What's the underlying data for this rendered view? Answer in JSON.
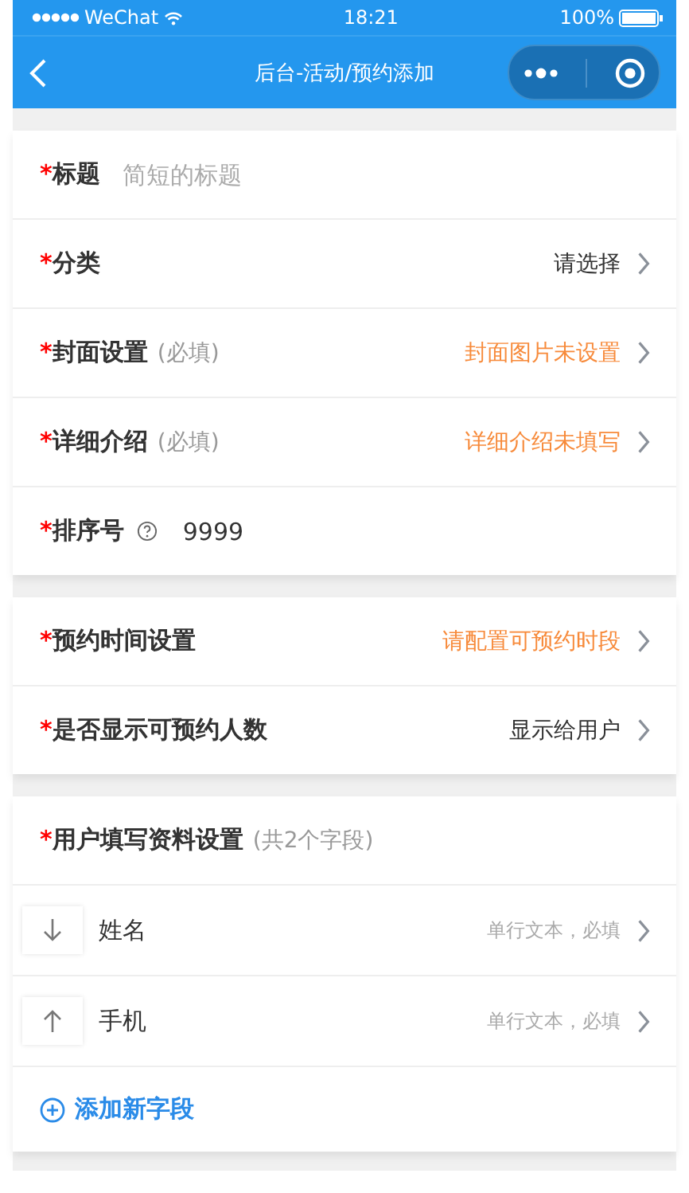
{
  "status_bar": {
    "carrier": "WeChat",
    "time": "18:21",
    "battery": "100%"
  },
  "nav": {
    "title": "后台-活动/预约添加"
  },
  "sections": [
    {
      "rows": [
        {
          "kind": "input",
          "required_mark": "*",
          "label": "标题",
          "placeholder": "简短的标题"
        },
        {
          "kind": "select",
          "required_mark": "*",
          "label": "分类",
          "value": "请选择",
          "warning": false
        },
        {
          "kind": "select",
          "required_mark": "*",
          "label": "封面设置",
          "hint": "(必填)",
          "value": "封面图片未设置",
          "warning": true
        },
        {
          "kind": "select",
          "required_mark": "*",
          "label": "详细介绍",
          "hint": "(必填)",
          "value": "详细介绍未填写",
          "warning": true
        },
        {
          "kind": "input",
          "required_mark": "*",
          "label": "排序号",
          "help": true,
          "value": "9999"
        }
      ]
    },
    {
      "rows": [
        {
          "kind": "select",
          "required_mark": "*",
          "label": "预约时间设置",
          "value": "请配置可预约时段",
          "warning": true
        },
        {
          "kind": "select",
          "required_mark": "*",
          "label": "是否显示可预约人数",
          "value": "显示给用户",
          "warning": false
        }
      ]
    }
  ],
  "user_fields": {
    "required_mark": "*",
    "label": "用户填写资料设置",
    "hint": "(共2个字段)",
    "fields": [
      {
        "name": "姓名",
        "detail": "单行文本，必填"
      },
      {
        "name": "手机",
        "detail": "单行文本，必填"
      }
    ],
    "add_label": "添加新字段"
  }
}
